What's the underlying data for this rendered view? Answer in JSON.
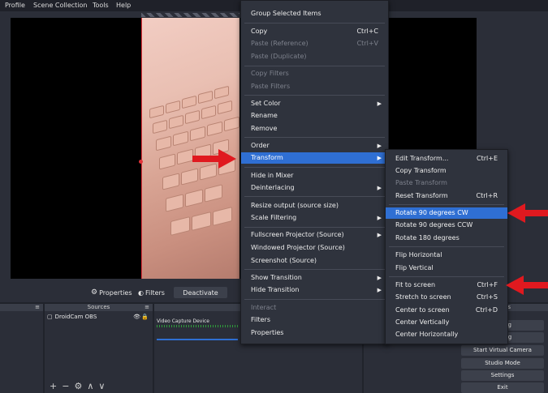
{
  "menubar": {
    "items": [
      "Profile",
      "Scene Collection",
      "Tools",
      "Help"
    ]
  },
  "toolbar": {
    "properties_label": "Properties",
    "filters_label": "Filters",
    "deactivate_label": "Deactivate"
  },
  "docks": {
    "sources_title": "Sources",
    "source_item": "DroidCam OBS",
    "mixer_source_name": "Video Capture Device",
    "audio_title": "A"
  },
  "controls": {
    "buttons": [
      "Start Streaming",
      "Start Recording",
      "Start Virtual Camera",
      "Studio Mode",
      "Settings",
      "Exit"
    ],
    "visible_labels": [
      "aming",
      "ording",
      "Start Virtual Camera",
      "Studio Mode",
      "Settings",
      "Exit"
    ],
    "tab_label": "ls"
  },
  "context_menu": {
    "items": [
      {
        "label": "Group Selected Items"
      },
      {
        "label": "Copy",
        "shortcut": "Ctrl+C"
      },
      {
        "label": "Paste (Reference)",
        "shortcut": "Ctrl+V",
        "disabled": true
      },
      {
        "label": "Paste (Duplicate)",
        "disabled": true
      },
      {
        "label": "Copy Filters",
        "disabled": true
      },
      {
        "label": "Paste Filters",
        "disabled": true
      },
      {
        "label": "Set Color",
        "submenu": true
      },
      {
        "label": "Rename"
      },
      {
        "label": "Remove"
      },
      {
        "label": "Order",
        "submenu": true
      },
      {
        "label": "Transform",
        "submenu": true,
        "highlighted": true
      },
      {
        "label": "Hide in Mixer"
      },
      {
        "label": "Deinterlacing",
        "submenu": true
      },
      {
        "label": "Resize output (source size)"
      },
      {
        "label": "Scale Filtering",
        "submenu": true
      },
      {
        "label": "Fullscreen Projector (Source)",
        "submenu": true
      },
      {
        "label": "Windowed Projector (Source)"
      },
      {
        "label": "Screenshot (Source)"
      },
      {
        "label": "Show Transition",
        "submenu": true
      },
      {
        "label": "Hide Transition",
        "submenu": true
      },
      {
        "label": "Interact",
        "disabled": true
      },
      {
        "label": "Filters"
      },
      {
        "label": "Properties"
      }
    ]
  },
  "transform_menu": {
    "items": [
      {
        "label": "Edit Transform...",
        "shortcut": "Ctrl+E"
      },
      {
        "label": "Copy Transform"
      },
      {
        "label": "Paste Transform",
        "disabled": true
      },
      {
        "label": "Reset Transform",
        "shortcut": "Ctrl+R"
      },
      {
        "label": "Rotate 90 degrees CW",
        "highlighted": true
      },
      {
        "label": "Rotate 90 degrees CCW"
      },
      {
        "label": "Rotate 180 degrees"
      },
      {
        "label": "Flip Horizontal"
      },
      {
        "label": "Flip Vertical"
      },
      {
        "label": "Fit to screen",
        "shortcut": "Ctrl+F"
      },
      {
        "label": "Stretch to screen",
        "shortcut": "Ctrl+S"
      },
      {
        "label": "Center to screen",
        "shortcut": "Ctrl+D"
      },
      {
        "label": "Center Vertically"
      },
      {
        "label": "Center Horizontally"
      }
    ]
  },
  "colors": {
    "highlight": "#2f6fd3",
    "selection_red": "#e0333a",
    "annotation_arrow": "#e0191f"
  }
}
